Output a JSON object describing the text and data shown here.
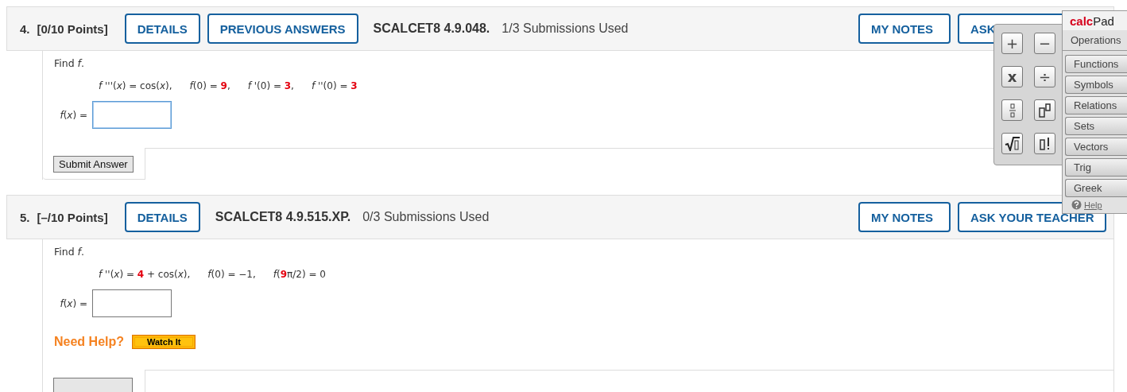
{
  "questions": [
    {
      "number": "4.",
      "points": "[0/10 Points]",
      "header_buttons": [
        "DETAILS",
        "PREVIOUS ANSWERS"
      ],
      "code": "SCALCET8 4.9.048.",
      "submissions": "1/3 Submissions Used",
      "right_buttons": [
        "MY NOTES",
        "ASK"
      ],
      "prompt": "Find *f*.",
      "equation": [
        [
          {
            "text": "*f* '''(*x*) = cos(*x*),",
            "red": false
          }
        ],
        [
          {
            "text": "*f*(0) = ",
            "red": false
          },
          {
            "text": "9",
            "red": true
          },
          {
            "text": ",",
            "red": false
          }
        ],
        [
          {
            "text": "*f* '(0) = ",
            "red": false
          },
          {
            "text": "3",
            "red": true
          },
          {
            "text": ",",
            "red": false
          }
        ],
        [
          {
            "text": "*f* ''(0) = ",
            "red": false
          },
          {
            "text": "3",
            "red": true
          }
        ]
      ],
      "answer_label": "*f*(*x*) =",
      "answer_focused": true,
      "submit": "Submit Answer"
    },
    {
      "number": "5.",
      "points": "[–/10 Points]",
      "header_buttons": [
        "DETAILS"
      ],
      "code": "SCALCET8 4.9.515.XP.",
      "submissions": "0/3 Submissions Used",
      "right_buttons": [
        "MY NOTES",
        "ASK YOUR TEACHER"
      ],
      "prompt": "Find *f*.",
      "equation": [
        [
          {
            "text": "*f* ''(*x*) = ",
            "red": false
          },
          {
            "text": "4",
            "red": true
          },
          {
            "text": " + cos(*x*),",
            "red": false
          }
        ],
        [
          {
            "text": "*f*(0) = −1,",
            "red": false
          }
        ],
        [
          {
            "text": "*f*(",
            "red": false
          },
          {
            "text": "9",
            "red": true
          },
          {
            "text": "π/2) = 0",
            "red": false
          }
        ]
      ],
      "answer_label": "*f*(*x*) =",
      "answer_focused": false,
      "need_help": {
        "label": "Need Help?",
        "button": "Watch It"
      },
      "submit_cut": true
    }
  ],
  "calcpad": {
    "title_red": "calc",
    "title": "Pad",
    "keys": [
      {
        "kind": "text",
        "label": "+"
      },
      {
        "kind": "text",
        "label": "−"
      },
      {
        "kind": "text",
        "label": "x",
        "bold": true
      },
      {
        "kind": "text",
        "label": "÷"
      },
      {
        "kind": "fraction"
      },
      {
        "kind": "power"
      },
      {
        "kind": "sqrt"
      },
      {
        "kind": "factorial"
      }
    ],
    "tabs": [
      {
        "label": "Operations",
        "selected": true
      },
      {
        "label": "Functions",
        "selected": false
      },
      {
        "label": "Symbols",
        "selected": false
      },
      {
        "label": "Relations",
        "selected": false
      },
      {
        "label": "Sets",
        "selected": false
      },
      {
        "label": "Vectors",
        "selected": false
      },
      {
        "label": "Trig",
        "selected": false
      },
      {
        "label": "Greek",
        "selected": false
      }
    ],
    "help": "Help"
  }
}
